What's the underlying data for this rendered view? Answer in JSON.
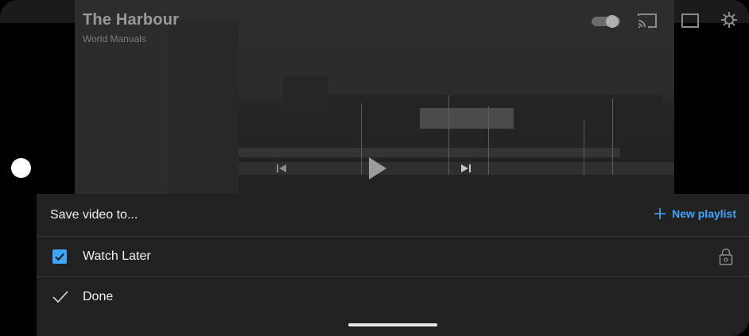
{
  "video": {
    "title": "The Harbour",
    "channel": "World Manuals"
  },
  "icons": {
    "autoplay": "autoplay-toggle-icon",
    "cast": "cast-icon",
    "add_to_queue": "add-to-queue-icon",
    "settings": "settings-icon",
    "previous": "previous-icon",
    "play": "play-icon",
    "next": "next-icon",
    "new_playlist": "plus-icon",
    "checkbox": "checkbox-checked-icon",
    "lock": "lock-icon",
    "done": "check-icon"
  },
  "sheet": {
    "title": "Save video to...",
    "new_playlist_label": "New playlist",
    "playlists": [
      {
        "label": "Watch Later",
        "checked": true,
        "private": true
      }
    ],
    "done_label": "Done"
  },
  "colors": {
    "accent": "#3ea6ff",
    "sheet_bg": "#212121",
    "text": "#f1f1f1",
    "divider": "#3a3a3a"
  }
}
